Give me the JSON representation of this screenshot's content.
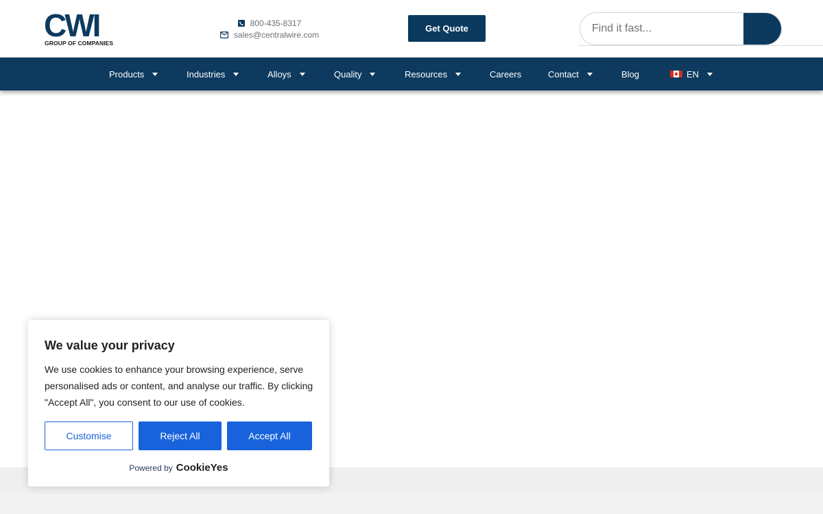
{
  "header": {
    "logo_text": "CWI",
    "logo_subtitle": "GROUP OF COMPANIES",
    "phone": "800-435-8317",
    "email": "sales@centralwire.com",
    "quote_button": "Get Quote",
    "search_placeholder": "Find it fast..."
  },
  "nav": {
    "items": [
      {
        "label": "Products",
        "dropdown": true
      },
      {
        "label": "Industries",
        "dropdown": true
      },
      {
        "label": "Alloys",
        "dropdown": true
      },
      {
        "label": "Quality",
        "dropdown": true
      },
      {
        "label": "Resources",
        "dropdown": true
      },
      {
        "label": "Careers",
        "dropdown": false
      },
      {
        "label": "Contact",
        "dropdown": true
      },
      {
        "label": "Blog",
        "dropdown": false
      }
    ],
    "language": "EN"
  },
  "cookie": {
    "title": "We value your privacy",
    "text": "We use cookies to enhance your browsing experience, serve personalised ads or content, and analyse our traffic. By clicking \"Accept All\", you consent to our use of cookies.",
    "customise": "Customise",
    "reject": "Reject All",
    "accept": "Accept All",
    "powered_by": "Powered by",
    "brand": "CookieYes"
  },
  "colors": {
    "brand_navy": "#0d3a5e",
    "cookie_blue": "#1863dc"
  }
}
